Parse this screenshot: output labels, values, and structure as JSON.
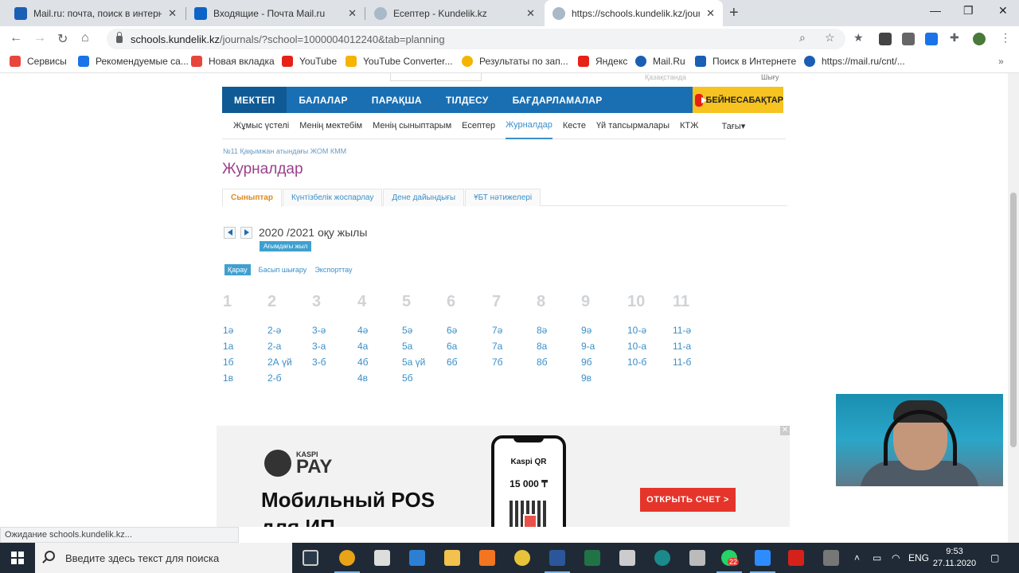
{
  "browser": {
    "tabs": [
      {
        "title": "Mail.ru: почта, поиск в интерне",
        "color": "#1a5fb4"
      },
      {
        "title": "Входящие - Почта Mail.ru",
        "color": "#0c64c8"
      },
      {
        "title": "Есептер - Kundelik.kz",
        "color": "#6a8fb0"
      },
      {
        "title": "https://schools.kundelik.kz/journ",
        "color": "#6a8fb0"
      }
    ],
    "url_host": "schools.kundelik.kz",
    "url_path": "/journals/?school=1000004012240&tab=planning",
    "bookmarks": [
      {
        "label": "Сервисы",
        "color": "#e8453c"
      },
      {
        "label": "Рекомендуемые са...",
        "color": "#1a73e8"
      },
      {
        "label": "Новая вкладка",
        "color": "#e8453c"
      },
      {
        "label": "YouTube",
        "color": "#e62117"
      },
      {
        "label": "YouTube Converter...",
        "color": "#f5b400"
      },
      {
        "label": "Результаты по зап...",
        "color": "#f5b400"
      },
      {
        "label": "Яндекс",
        "color": "#e62117"
      },
      {
        "label": "Mail.Ru",
        "color": "#1a5fb4"
      },
      {
        "label": "Поиск в Интернете",
        "color": "#1a5fb4"
      },
      {
        "label": "https://mail.ru/cnt/...",
        "color": "#1a5fb4"
      }
    ]
  },
  "site": {
    "topfrag_right": "Қазақстанда",
    "topfrag_right2": "Шығу",
    "main_nav": [
      "МЕКТЕП",
      "БАЛАЛАР",
      "ПАРАҚША",
      "ТІЛДЕСУ",
      "БАҒДАРЛАМАЛАР"
    ],
    "video_button": "БЕЙНЕСАБАҚТАР",
    "sub_nav": [
      "Жұмыс үстелі",
      "Менің мектебім",
      "Менің сыныптарым",
      "Есептер",
      "Журналдар",
      "Кесте",
      "Үй тапсырмалары",
      "КТЖ",
      "Тағы▾"
    ],
    "school_name": "№11 Қақымжан атындағы ЖОМ КММ",
    "page_title": "Журналдар",
    "tabs": [
      "Сыныптар",
      "Күнтізбелік жоспарлау",
      "Дене дайындығы",
      "ҰБТ нәтижелері"
    ],
    "year": "2020 /2021 оқу жылы",
    "current_year_badge": "Ағымдағы жыл",
    "actions": [
      "Қарау",
      "Басып шығару",
      "Экспорттау"
    ],
    "grades": [
      {
        "num": "1",
        "classes": [
          "1ә",
          "1а",
          "1б",
          "1в"
        ]
      },
      {
        "num": "2",
        "classes": [
          "2-ә",
          "2-а",
          "2А үй",
          "2-б"
        ]
      },
      {
        "num": "3",
        "classes": [
          "3-ә",
          "3-а",
          "3-б"
        ]
      },
      {
        "num": "4",
        "classes": [
          "4ә",
          "4а",
          "4б",
          "4в"
        ]
      },
      {
        "num": "5",
        "classes": [
          "5ә",
          "5а",
          "5а үй",
          "5б"
        ]
      },
      {
        "num": "6",
        "classes": [
          "6ә",
          "6а",
          "6б"
        ]
      },
      {
        "num": "7",
        "classes": [
          "7ә",
          "7а",
          "7б"
        ]
      },
      {
        "num": "8",
        "classes": [
          "8ә",
          "8а",
          "8б"
        ]
      },
      {
        "num": "9",
        "classes": [
          "9ә",
          "9-а",
          "9б",
          "9в"
        ]
      },
      {
        "num": "10",
        "classes": [
          "10-ә",
          "10-а",
          "10-б"
        ]
      },
      {
        "num": "11",
        "classes": [
          "11-ә",
          "11-а",
          "11-б"
        ]
      }
    ]
  },
  "ad": {
    "brand_small": "KASPI",
    "brand_big": "PAY",
    "headline": "Мобильный POS",
    "headline2": "для ИП",
    "qr_title": "Kaspi QR",
    "qr_amount": "15 000 ₸",
    "button": "ОТКРЫТЬ СЧЕТ >"
  },
  "status": "Ожидание schools.kundelik.kz...",
  "taskbar": {
    "search_placeholder": "Введите здесь текст для поиска",
    "lang": "ENG",
    "time": "9:53",
    "date": "27.11.2020",
    "whatsapp_badge": "22"
  }
}
